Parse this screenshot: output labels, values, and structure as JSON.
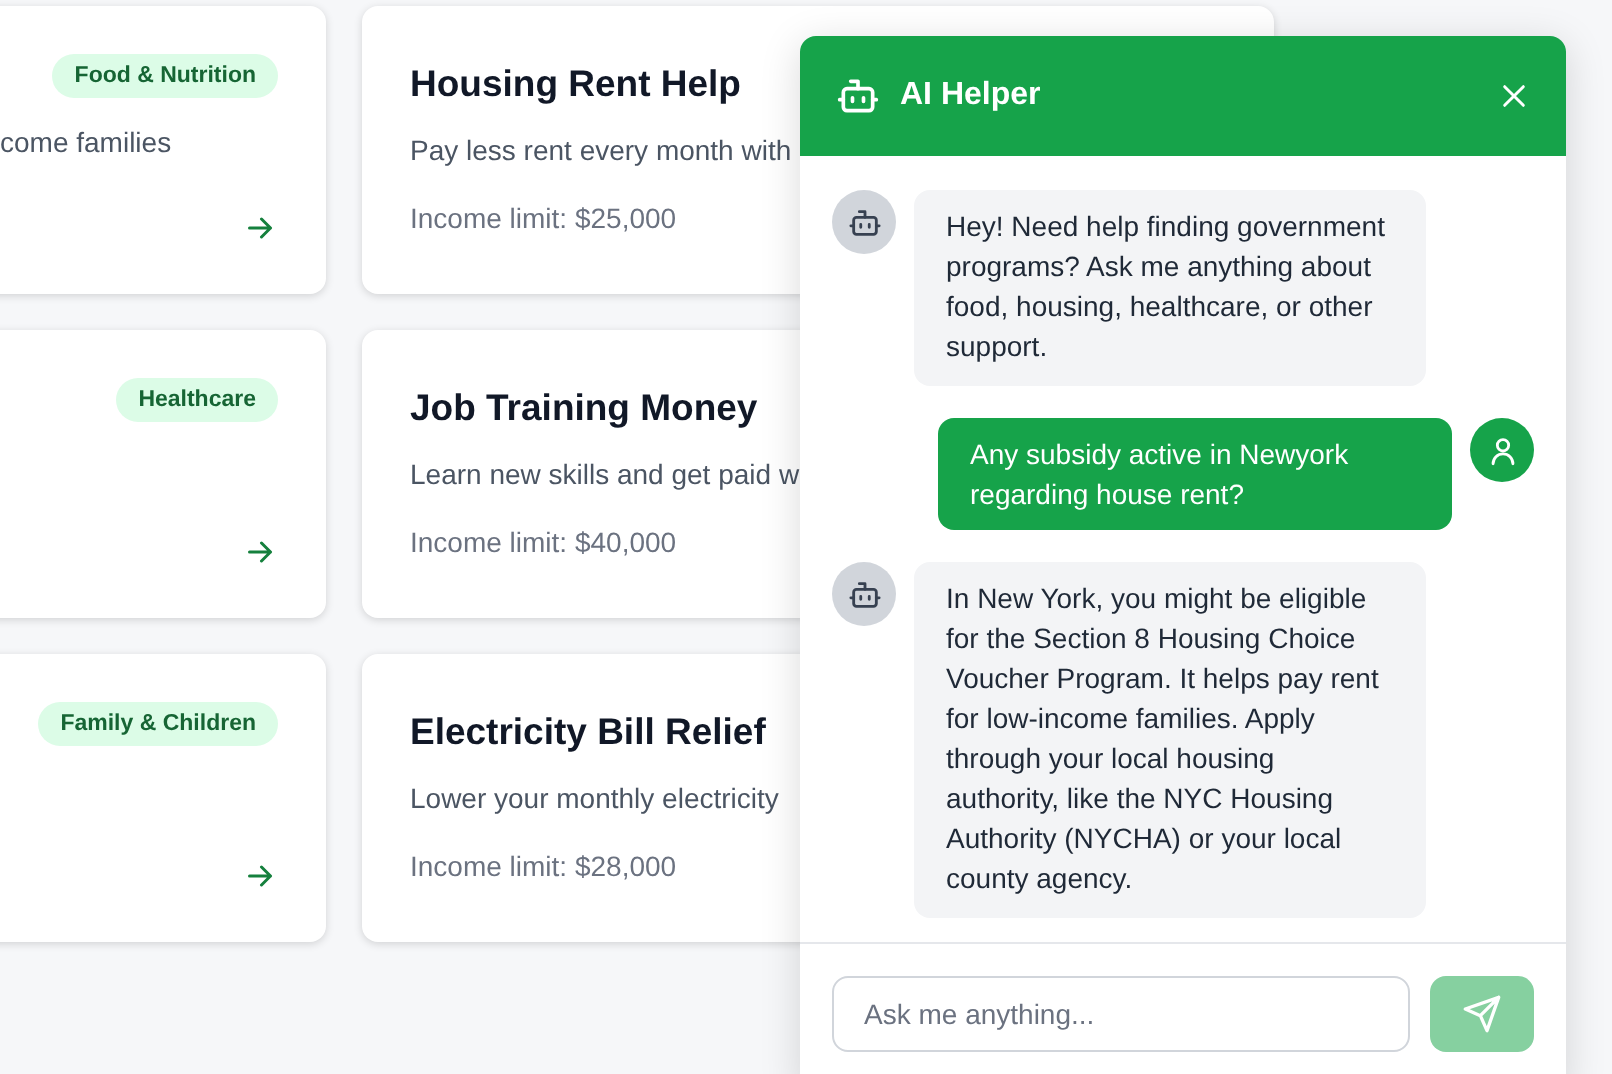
{
  "programs": {
    "left_column": [
      {
        "tag": "Food & Nutrition",
        "description": "come families"
      },
      {
        "tag": "Healthcare"
      },
      {
        "tag": "Family & Children"
      }
    ],
    "right_column": [
      {
        "title": "Housing Rent Help",
        "description": "Pay less rent every month with",
        "income_limit": "Income limit: $25,000"
      },
      {
        "title": "Job Training Money",
        "description": "Learn new skills and get paid w",
        "income_limit": "Income limit: $40,000"
      },
      {
        "title": "Electricity Bill Relief",
        "description": "Lower your monthly electricity",
        "income_limit": "Income limit: $28,000"
      }
    ]
  },
  "chat": {
    "title": "AI Helper",
    "messages": [
      {
        "kind": "bot",
        "text": "Hey! Need help finding government programs? Ask me anything about food, housing, healthcare, or other support."
      },
      {
        "kind": "user",
        "text": "Any subsidy active in Newyork regarding house rent?"
      },
      {
        "kind": "bot",
        "text": "In New York, you might be eligible for the Section 8 Housing Choice Voucher Program. It helps pay rent for low-income families. Apply through your local housing authority, like the NYC Housing Authority (NYCHA) or your local county agency."
      }
    ],
    "input": {
      "placeholder": "Ask me anything..."
    },
    "send_button": {
      "disabled": true
    }
  }
}
